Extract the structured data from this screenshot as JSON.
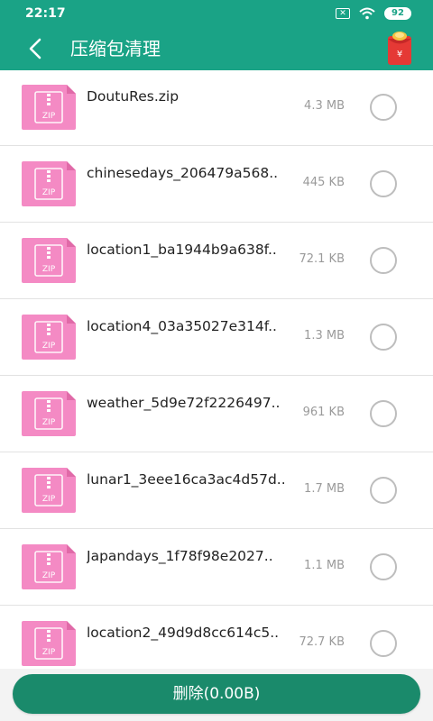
{
  "status_bar": {
    "time": "22:17",
    "sim_icon": "no-sim-icon",
    "wifi_icon": "wifi-icon",
    "battery_level": "92"
  },
  "header": {
    "title": "压缩包清理",
    "back_icon": "chevron-left-icon",
    "red_packet_icon": "red-envelope-icon"
  },
  "colors": {
    "header_bg": "#1aa386",
    "button_bg": "#1a8a6b",
    "zip_pink": "#f48ac4"
  },
  "files": [
    {
      "name": "DoutuRes.zip",
      "size": "4.3 MB"
    },
    {
      "name": "chinesedays_206479a568..",
      "size": "445 KB"
    },
    {
      "name": "location1_ba1944b9a638f..",
      "size": "72.1 KB"
    },
    {
      "name": "location4_03a35027e314f..",
      "size": "1.3 MB"
    },
    {
      "name": "weather_5d9e72f2226497..",
      "size": "961 KB"
    },
    {
      "name": "lunar1_3eee16ca3ac4d57d..",
      "size": "1.7 MB"
    },
    {
      "name": "Japandays_1f78f98e2027..",
      "size": "1.1 MB"
    },
    {
      "name": "location2_49d9d8cc614c5..",
      "size": "72.7 KB"
    }
  ],
  "zip_label": "ZIP",
  "footer": {
    "delete_label": "删除(0.00B)"
  }
}
